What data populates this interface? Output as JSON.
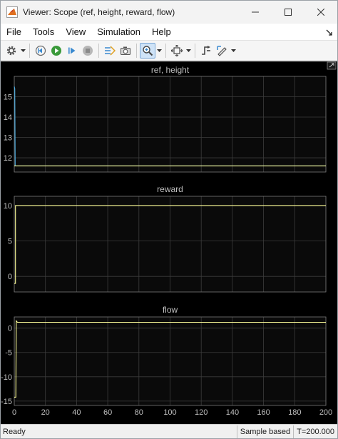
{
  "window": {
    "title": "Viewer: Scope (ref, height, reward, flow)",
    "icon": "matlab-icon",
    "controls": [
      "minimize-icon",
      "maximize-icon",
      "close-icon"
    ]
  },
  "menu": {
    "items": [
      "File",
      "Tools",
      "View",
      "Simulation",
      "Help"
    ]
  },
  "toolbar": {
    "buttons": [
      "settings-icon",
      "step-back-icon",
      "run-icon",
      "step-forward-icon",
      "stop-icon",
      "highlight-signal-icon",
      "snapshot-icon",
      "zoom-in-icon",
      "fit-to-view-icon",
      "triggers-icon",
      "cursor-measurements-icon"
    ],
    "active_button": "zoom-in-icon"
  },
  "status": {
    "left": "Ready",
    "mode": "Sample based",
    "time": "T=200.000"
  },
  "colors": {
    "background": "#000000",
    "axes": "#0a0a0a",
    "grid": "#3c3c3c",
    "text": "#bfbfbf",
    "series_blue": "#4fb3e8",
    "series_yellow": "#ffff99"
  },
  "chart_data": [
    {
      "type": "line",
      "title": "ref, height",
      "xlim": [
        0,
        200
      ],
      "ylim": [
        11.3,
        16
      ],
      "xticks": [
        0,
        20,
        40,
        60,
        80,
        100,
        120,
        140,
        160,
        180,
        200
      ],
      "yticks": [
        12,
        13,
        14,
        15
      ],
      "ytick_labels": [
        "12",
        "13",
        "14",
        "15"
      ],
      "show_xtick_labels": false,
      "grid": true,
      "series": [
        {
          "color": "#4fb3e8",
          "x": [
            0,
            0.3,
            0.6,
            200
          ],
          "y": [
            15.5,
            15.4,
            11.6,
            11.6
          ]
        },
        {
          "color": "#ffff99",
          "x": [
            0,
            0.3,
            200
          ],
          "y": [
            11.6,
            11.6,
            11.6
          ]
        }
      ]
    },
    {
      "type": "line",
      "title": "reward",
      "xlim": [
        0,
        200
      ],
      "ylim": [
        -2.2,
        11.3
      ],
      "xticks": [
        0,
        20,
        40,
        60,
        80,
        100,
        120,
        140,
        160,
        180,
        200
      ],
      "yticks": [
        0,
        5,
        10
      ],
      "ytick_labels": [
        "0",
        "5",
        "10"
      ],
      "show_xtick_labels": false,
      "grid": true,
      "series": [
        {
          "color": "#ffff99",
          "x": [
            0,
            0.8,
            0.8,
            200
          ],
          "y": [
            -1,
            -1,
            10,
            10
          ]
        }
      ]
    },
    {
      "type": "line",
      "title": "flow",
      "xlim": [
        0,
        200
      ],
      "ylim": [
        -15.9,
        2.3
      ],
      "xticks": [
        0,
        20,
        40,
        60,
        80,
        100,
        120,
        140,
        160,
        180,
        200
      ],
      "xtick_labels": [
        "0",
        "20",
        "40",
        "60",
        "80",
        "100",
        "120",
        "140",
        "160",
        "180",
        "200"
      ],
      "yticks": [
        -15,
        -10,
        -5,
        0
      ],
      "ytick_labels": [
        "-15",
        "-10",
        "-5",
        "0"
      ],
      "show_xtick_labels": true,
      "grid": true,
      "series": [
        {
          "color": "#ffff99",
          "x": [
            0,
            1,
            1.3,
            2,
            200
          ],
          "y": [
            -14.2,
            -14.2,
            1.5,
            1.2,
            1.2
          ]
        }
      ]
    }
  ]
}
